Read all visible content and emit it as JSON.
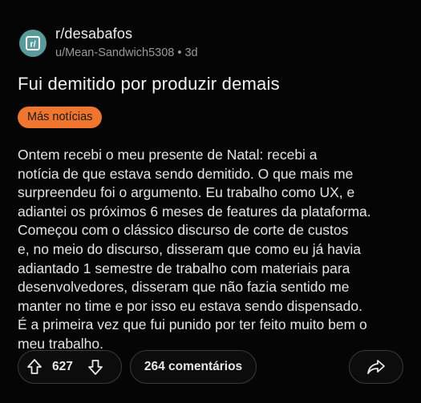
{
  "post": {
    "subreddit": "r/desabafos",
    "avatar_letter": "r/",
    "author": "u/Mean-Sandwich5308",
    "separator": "•",
    "age": "3d",
    "title": "Fui demitido por produzir demais",
    "flair": "Más notícias",
    "flair_color": "#f0752f",
    "body_lines": [
      "Ontem recebi o meu presente de Natal: recebi a",
      "notícia de que estava sendo demitido. O que mais me",
      "surpreendeu foi o argumento. Eu trabalho como UX, e",
      "adiantei os próximos 6 meses de features da plataforma.",
      "Começou com o clássico discurso de corte de custos",
      "e, no meio do discurso, disseram que como eu já havia",
      "adiantado 1 semestre de trabalho com materiais para",
      "desenvolvedores, disseram que não fazia sentido me",
      "manter no time e por isso eu estava sendo dispensado.",
      "É a primeira vez que fui punido por ter feito muito bem o",
      "meu trabalho."
    ]
  },
  "actions": {
    "upvote_icon": "arrow-up-icon",
    "score": "627",
    "downvote_icon": "arrow-down-icon",
    "comments_label": "264 comentários",
    "share_icon": "share-icon"
  },
  "colors": {
    "background": "#050505",
    "avatar": "#5a9a9a",
    "pill_border": "#3a3a3a"
  }
}
